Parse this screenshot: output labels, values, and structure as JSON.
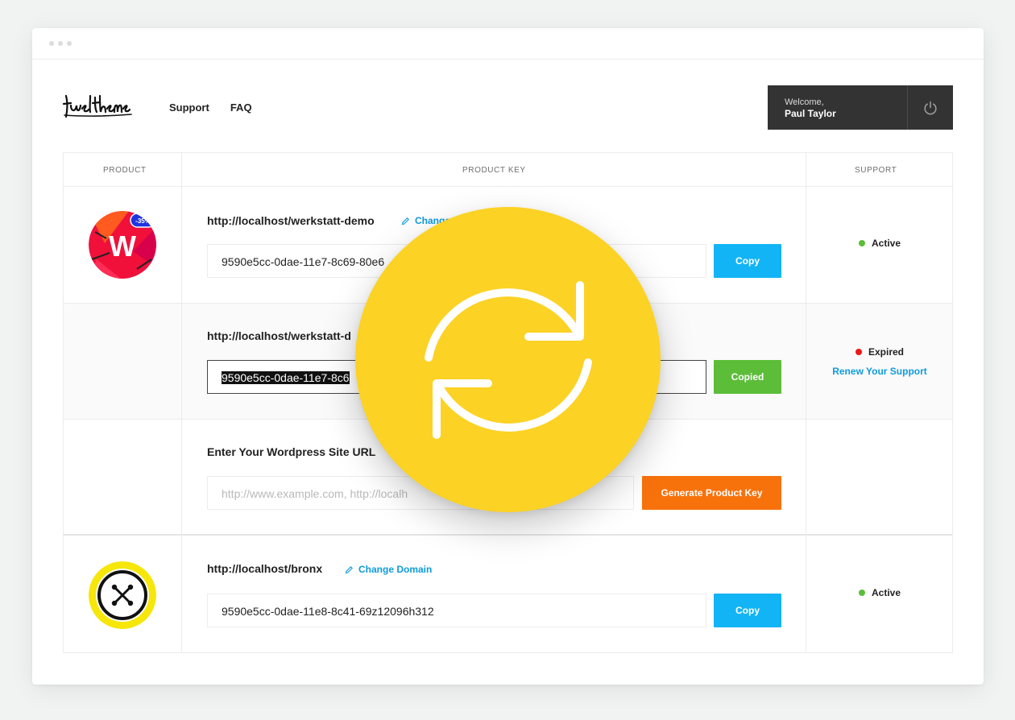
{
  "brand": {
    "logo_text": "fuel themes"
  },
  "nav": {
    "support": "Support",
    "faq": "FAQ"
  },
  "user": {
    "welcome": "Welcome,",
    "name": "Paul Taylor"
  },
  "table": {
    "headers": {
      "product": "PRODUCT",
      "product_key": "PRODUCT KEY",
      "support": "SUPPORT"
    },
    "rows": [
      {
        "badge": "-35%",
        "domain": "http://localhost/werkstatt-demo",
        "change_label": "Change D",
        "key": "9590e5cc-0dae-11e7-8c69-80e6",
        "button": "Copy",
        "status": "Active",
        "status_color": "#5cbd39"
      },
      {
        "domain": "http://localhost/werkstatt-d",
        "key": "9590e5cc-0dae-11e7-8c6",
        "button": "Copied",
        "status": "Expired",
        "status_color": "#ef1717",
        "renew": "Renew Your Support"
      },
      {
        "prompt": "Enter Your Wordpress Site URL",
        "placeholder": "http://www.example.com, http://localh",
        "button": "Generate Product Key"
      },
      {
        "domain": "http://localhost/bronx",
        "change_label": "Change Domain",
        "key": "9590e5cc-0dae-11e8-8c41-69z12096h312",
        "button": "Copy",
        "status": "Active",
        "status_color": "#5cbd39"
      }
    ]
  },
  "icons": {
    "power": "power-icon",
    "pencil": "pencil-icon",
    "sync": "sync-icon"
  },
  "colors": {
    "accent_blue": "#12b4f5",
    "link_blue": "#0f9bdc",
    "success": "#5cbd39",
    "warning_orange": "#f8720c",
    "sync_yellow": "#fcd224",
    "user_box": "#333333"
  }
}
